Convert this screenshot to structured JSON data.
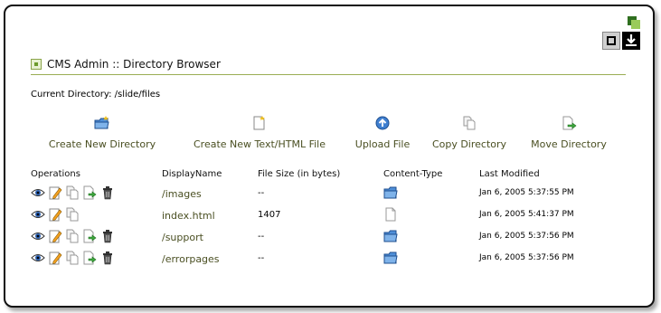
{
  "header": {
    "title": "CMS Admin :: Directory Browser"
  },
  "window_controls": {
    "icons": [
      "expand-icon",
      "download-icon"
    ]
  },
  "current_directory": "Current Directory: /slide/files",
  "actions": [
    {
      "label": "Create New Directory",
      "icon": "new-folder-icon"
    },
    {
      "label": "Create New Text/HTML File",
      "icon": "new-file-icon"
    },
    {
      "label": "Upload File",
      "icon": "upload-icon"
    },
    {
      "label": "Copy Directory",
      "icon": "copy-icon"
    },
    {
      "label": "Move Directory",
      "icon": "move-icon"
    }
  ],
  "table": {
    "headers": [
      "Operations",
      "DisplayName",
      "File Size (in bytes)",
      "Content-Type",
      "Last Modified"
    ],
    "rows": [
      {
        "name": "/images",
        "size": "--",
        "type": "folder",
        "modified": "Jan 6, 2005 5:37:55 PM",
        "ops": [
          "view",
          "edit",
          "copy",
          "move",
          "delete"
        ]
      },
      {
        "name": "index.html",
        "size": "1407",
        "type": "file",
        "modified": "Jan 6, 2005 5:41:37 PM",
        "ops": [
          "view",
          "edit",
          "copy"
        ]
      },
      {
        "name": "/support",
        "size": "--",
        "type": "folder",
        "modified": "Jan 6, 2005 5:37:56 PM",
        "ops": [
          "view",
          "edit",
          "copy",
          "move",
          "delete"
        ]
      },
      {
        "name": "/errorpages",
        "size": "--",
        "type": "folder",
        "modified": "Jan 6, 2005 5:37:56 PM",
        "ops": [
          "view",
          "edit",
          "copy",
          "move",
          "delete"
        ]
      }
    ]
  }
}
